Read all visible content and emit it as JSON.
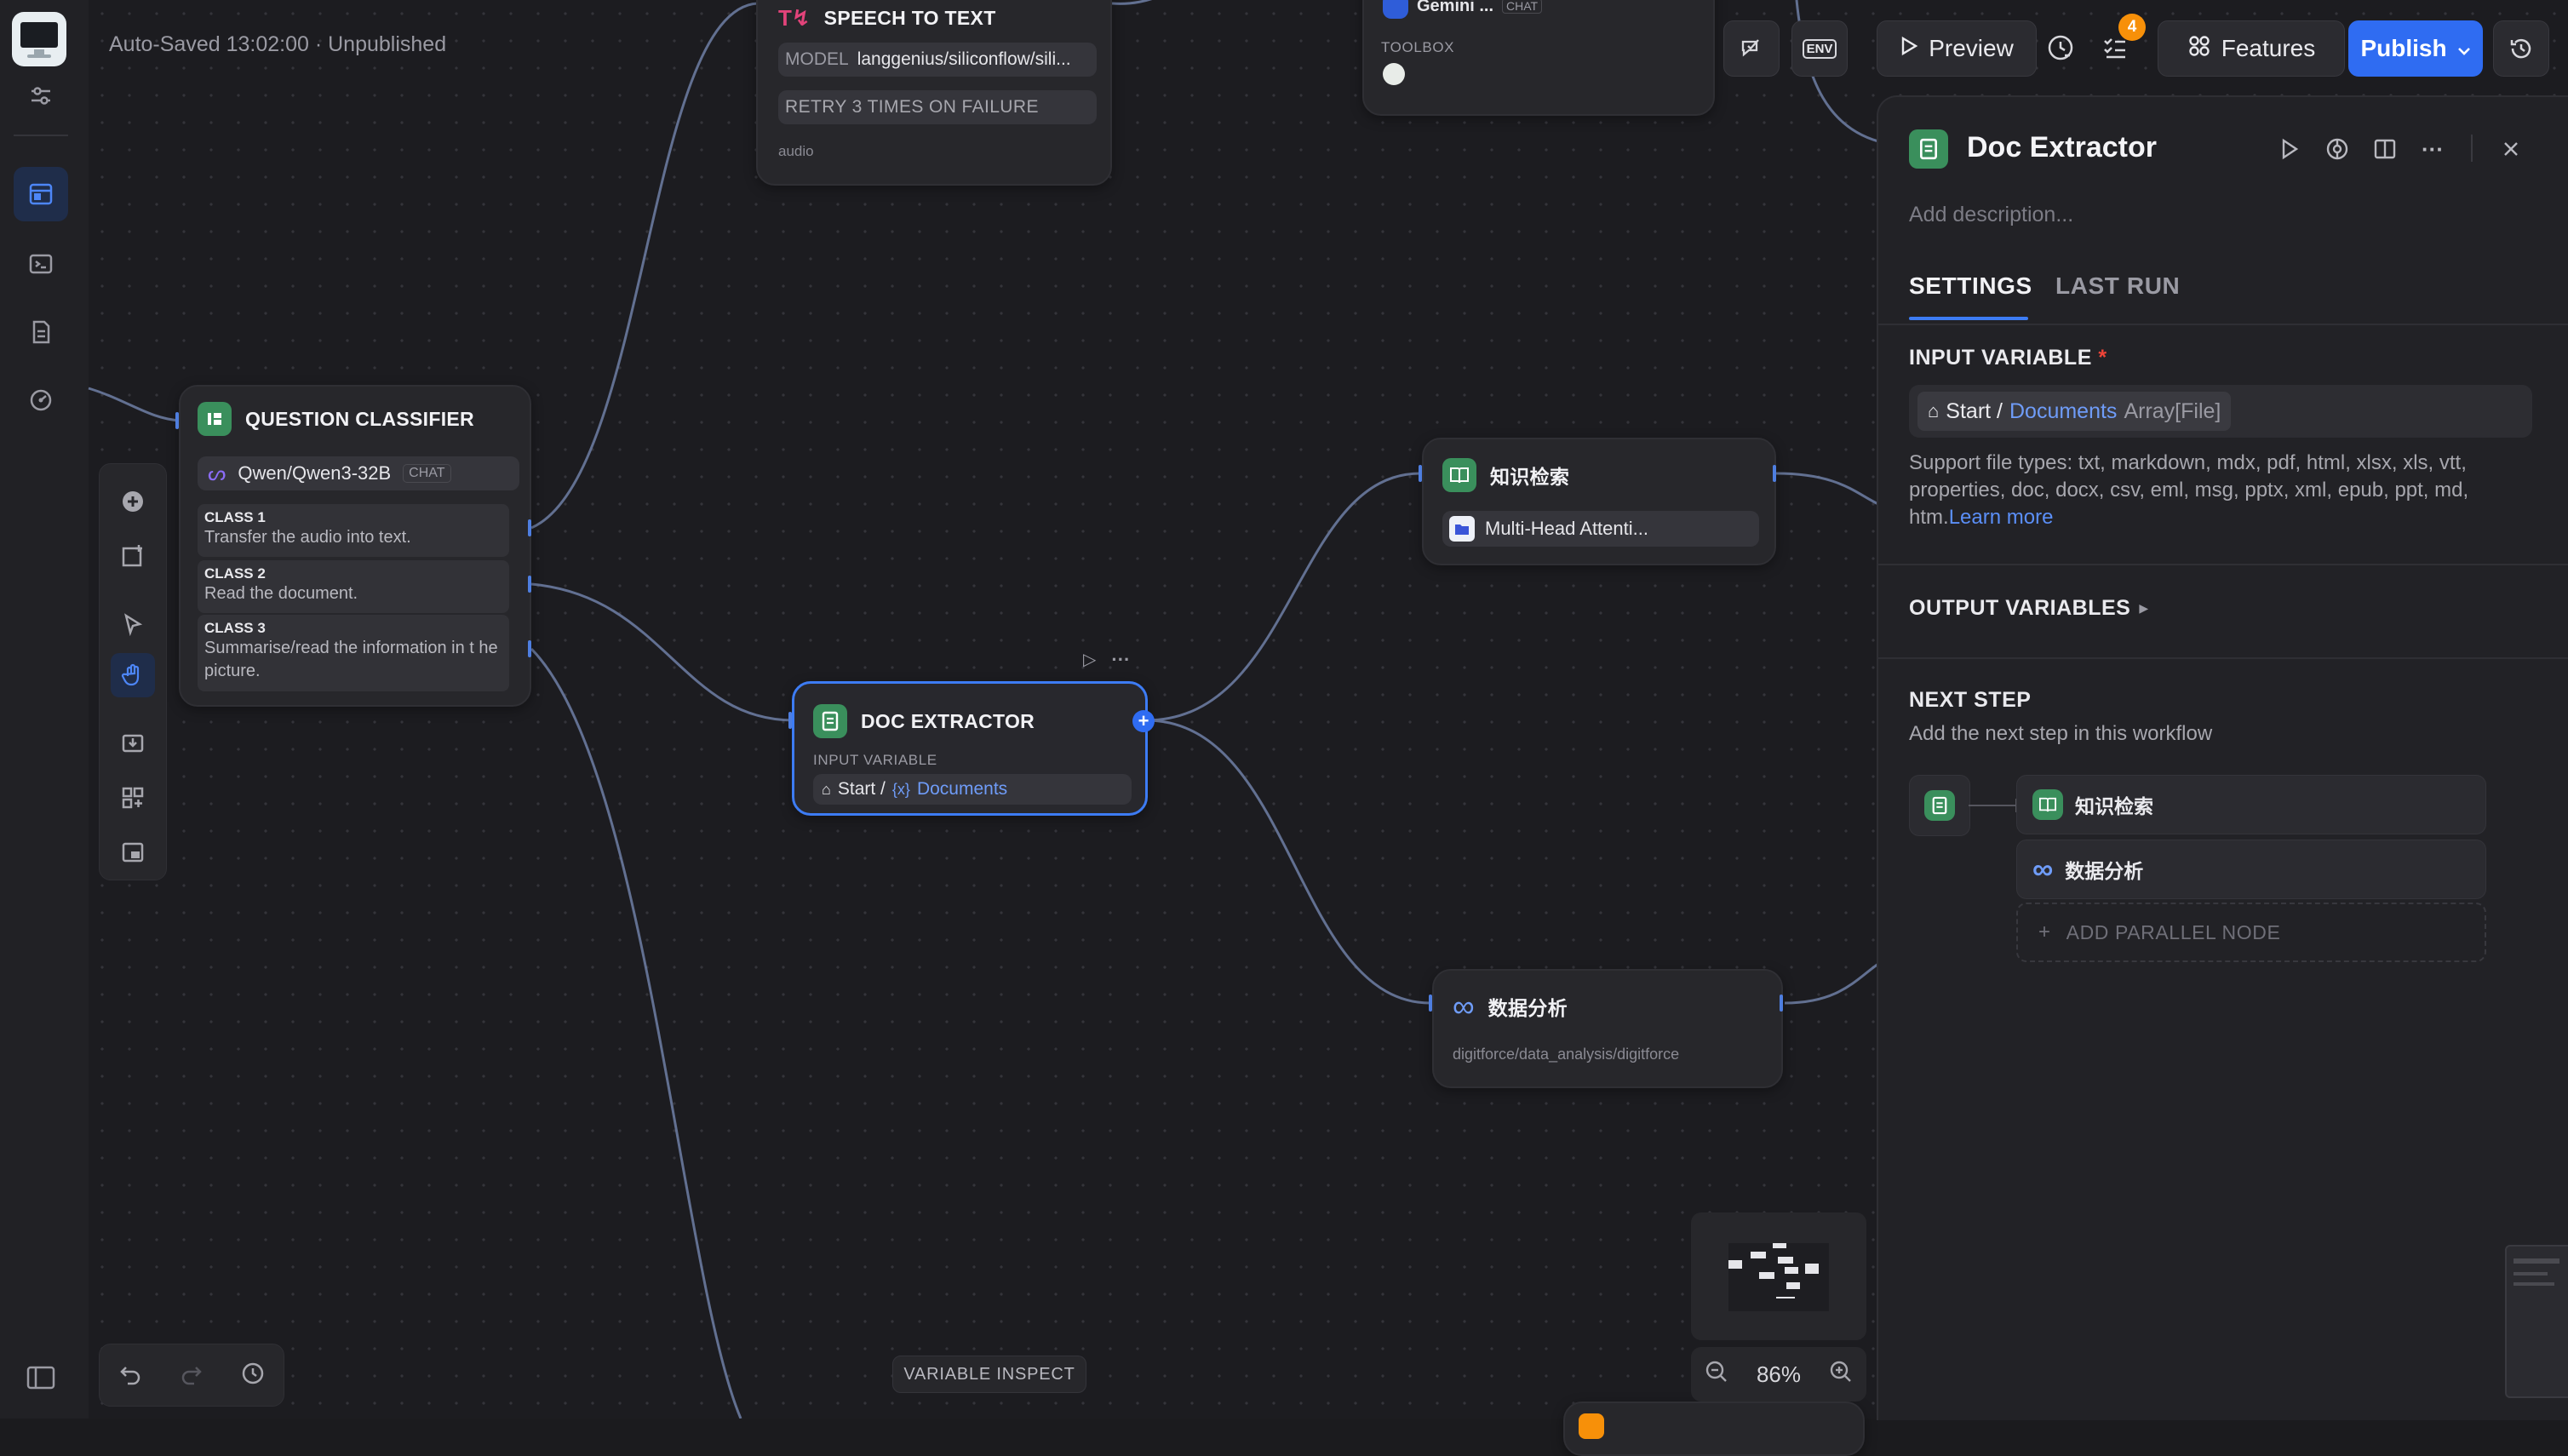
{
  "status": {
    "autosave": "Auto-Saved 13:02:00 · Unpublished"
  },
  "top_actions": {
    "env_label": "ENV",
    "preview_label": "Preview",
    "checklist_badge": "4",
    "features_label": "Features",
    "publish_label": "Publish"
  },
  "nodes": {
    "speech_to_text": {
      "title": "SPEECH TO TEXT",
      "model_label": "MODEL",
      "model_value": "langgenius/siliconflow/sili...",
      "retry": "RETRY 3 TIMES ON FAILURE",
      "output": "audio"
    },
    "toolbox_node": {
      "title": "Gemini ...",
      "chip": "CHAT",
      "label": "TOOLBOX"
    },
    "question_classifier": {
      "title": "QUESTION CLASSIFIER",
      "model": "Qwen/Qwen3-32B",
      "model_tag": "CHAT",
      "classes": [
        {
          "name": "CLASS 1",
          "desc": "Transfer the audio into text."
        },
        {
          "name": "CLASS 2",
          "desc": "Read the document."
        },
        {
          "name": "CLASS 3",
          "desc": "Summarise/read the information in t he picture."
        }
      ]
    },
    "doc_extractor": {
      "title": "DOC EXTRACTOR",
      "input_label": "INPUT VARIABLE",
      "var_source": "Start /",
      "var_prefix": "{x}",
      "var_name": "Documents"
    },
    "knowledge": {
      "title": "知识检索",
      "dataset": "Multi-Head Attenti..."
    },
    "data_analysis": {
      "title": "数据分析",
      "subtitle": "digitforce/data_analysis/digitforce"
    }
  },
  "bottom": {
    "variable_inspect": "VARIABLE INSPECT",
    "zoom": "86%"
  },
  "panel": {
    "title": "Doc Extractor",
    "description_placeholder": "Add description...",
    "tabs": [
      "SETTINGS",
      "LAST RUN"
    ],
    "input_variable_title": "INPUT VARIABLE",
    "required_mark": "*",
    "var_source": "Start /",
    "var_name": "Documents",
    "var_type": "Array[File]",
    "support_text": "Support file types: txt, markdown, mdx, pdf, html, xlsx, xls, vtt, properties, doc, docx, csv, eml, msg, pptx, xml, epub, ppt, md, htm.",
    "learn_more": "Learn more",
    "output_variables_title": "OUTPUT VARIABLES",
    "next_step_title": "NEXT STEP",
    "next_step_desc": "Add the next step in this workflow",
    "next_nodes": [
      "知识检索",
      "数据分析"
    ],
    "add_parallel": "ADD PARALLEL NODE"
  },
  "colors": {
    "accent": "#3d7cf4",
    "node_green": "#3a8f5c",
    "badge_orange": "#f79009"
  }
}
